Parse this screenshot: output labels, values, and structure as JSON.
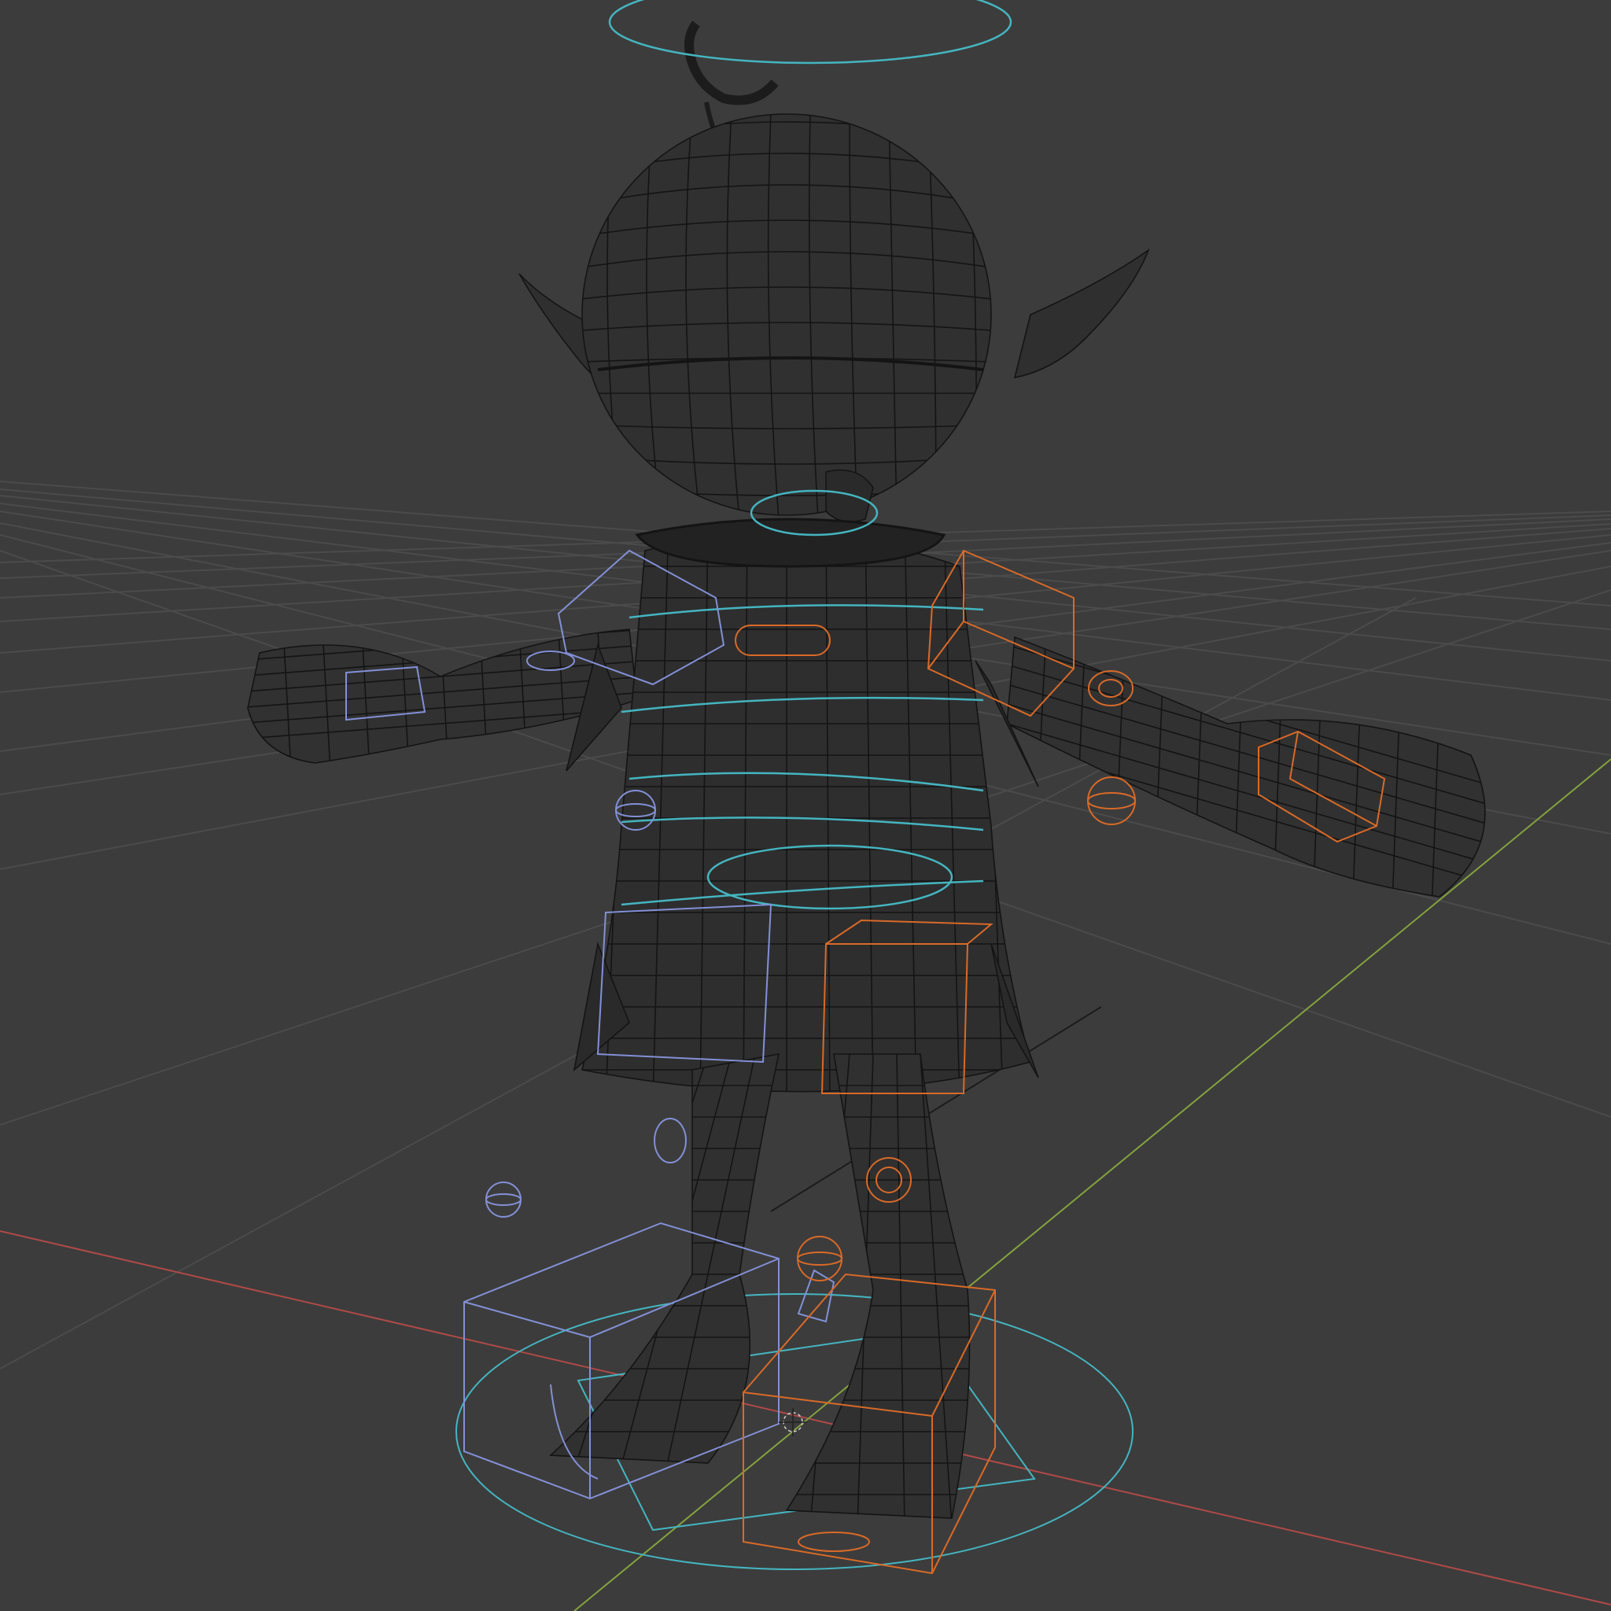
{
  "viewport": {
    "background_color": "#3c3c3c",
    "grid_color": "#4a4a4a",
    "axis_x_color": "#c0504d",
    "axis_y_color": "#8ea843",
    "mesh_color": "#151515",
    "rig_cyan_color": "#45b5c0",
    "rig_blue_color": "#8390d6",
    "rig_orange_color": "#d96a28",
    "view_mode": "wireframe",
    "cursor_icon": "3d-cursor-icon"
  }
}
